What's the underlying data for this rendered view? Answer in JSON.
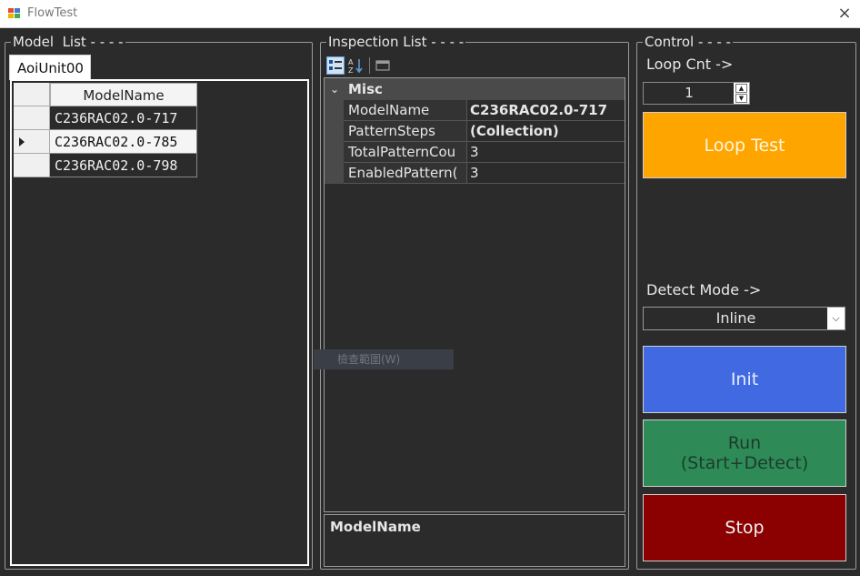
{
  "window": {
    "title": "FlowTest",
    "close_icon": "×"
  },
  "model_list": {
    "title": "Model  List - - - -",
    "tab_label": "AoiUnit00",
    "column_header": "ModelName",
    "rows": [
      "C236RAC02.0-717",
      "C236RAC02.0-785",
      "C236RAC02.0-798"
    ],
    "current_row_index": 1
  },
  "inspection": {
    "title": "Inspection List - - - -",
    "category": "Misc",
    "category_chevron": "⌄",
    "properties": [
      {
        "name": "ModelName",
        "value": "C236RAC02.0-717",
        "bold": true
      },
      {
        "name": "PatternSteps",
        "value": "(Collection)",
        "bold": true
      },
      {
        "name": "TotalPatternCou",
        "value": "3",
        "bold": false
      },
      {
        "name": "EnabledPattern(",
        "value": "3",
        "bold": false
      }
    ],
    "description_title": "ModelName",
    "context_hint": "檢查範圍(W)"
  },
  "control": {
    "title": "Control - - - -",
    "loop_cnt_label": "Loop Cnt ->",
    "loop_cnt_value": "1",
    "loop_test_label": "Loop Test",
    "detect_mode_label": "Detect Mode ->",
    "detect_mode_value": "Inline",
    "init_label": "Init",
    "run_label": "Run\n(Start+Detect)",
    "stop_label": "Stop"
  },
  "colors": {
    "background": "#2b2b2b",
    "loop_test": "#ffa500",
    "init": "#4169e1",
    "run": "#2e8b57",
    "stop": "#8b0000"
  }
}
